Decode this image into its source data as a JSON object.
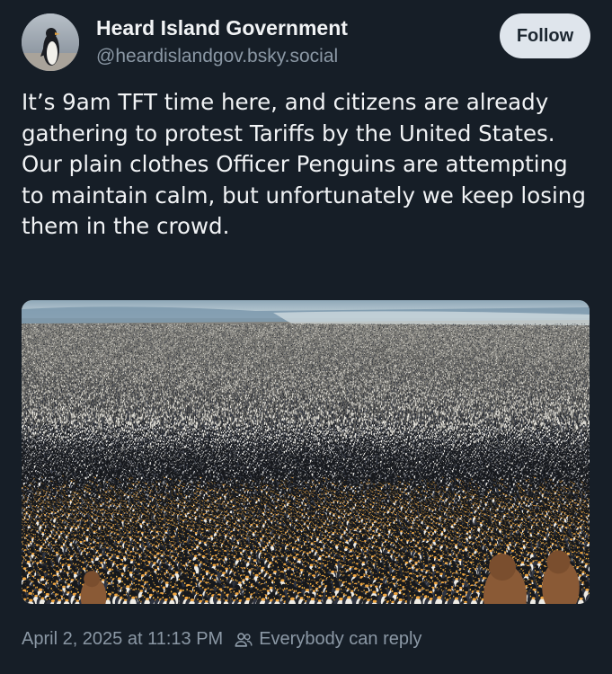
{
  "post": {
    "author": {
      "display_name": "Heard Island Government",
      "handle": "@heardislandgov.bsky.social",
      "avatar_icon": "penguin-avatar"
    },
    "follow_label": "Follow",
    "text": "It’s 9am TFT time here, and citizens are already gathering to protest Tariffs by the United States. Our plain clothes Officer Penguins are attempting to maintain calm, but unfortunately we keep losing them in the crowd.",
    "media": {
      "type": "photo",
      "icon": "penguin-crowd-photo"
    },
    "timestamp": "April 2, 2025 at 11:13 PM",
    "reply_setting": {
      "icon": "people-icon",
      "label": "Everybody can reply"
    }
  },
  "colors": {
    "background": "#161e27",
    "text_primary": "#f1f3f5",
    "text_secondary": "#8b98a5",
    "follow_button_bg": "#dfe5ec"
  }
}
